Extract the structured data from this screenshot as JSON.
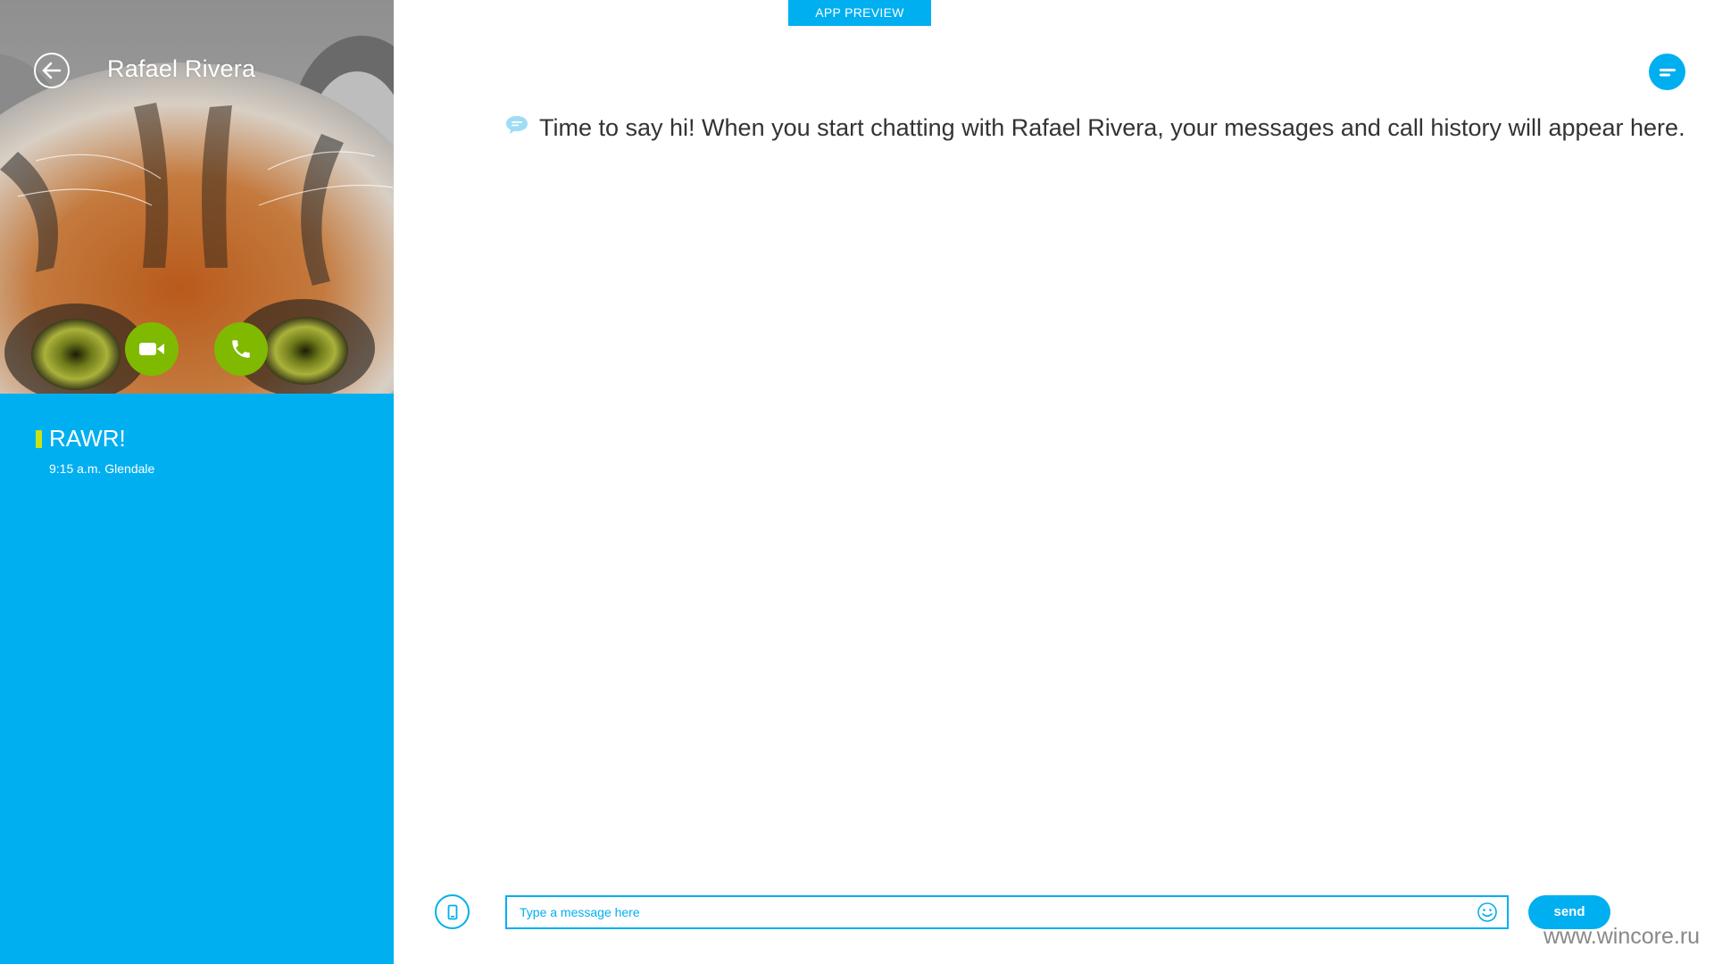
{
  "badge": {
    "label": "APP PREVIEW"
  },
  "contact": {
    "name": "Rafael Rivera",
    "mood": "RAWR!",
    "local_time": "9:15  a.m. Glendale"
  },
  "conversation": {
    "empty_message": "Time to say hi! When you start chatting with Rafael Rivera, your messages and call history will appear here."
  },
  "composer": {
    "placeholder": "Type a message here",
    "send_label": "send"
  },
  "watermark": "www.wincore.ru",
  "colors": {
    "accent": "#00aff0",
    "call_green": "#7fba00",
    "presence_online": "#c8e21a"
  },
  "icons": {
    "back": "arrow-left-icon",
    "video": "video-camera-icon",
    "voice": "phone-icon",
    "menu": "menu-icon",
    "chat": "chat-bubble-icon",
    "sms": "mobile-phone-icon",
    "emoticon": "smiley-icon"
  }
}
